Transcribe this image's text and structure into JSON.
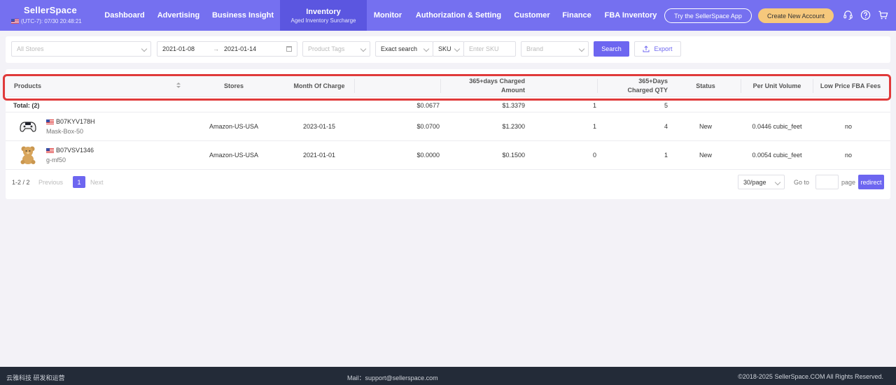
{
  "brand": {
    "name": "SellerSpace",
    "time": "(UTC-7): 07/30 20:48:21"
  },
  "nav": {
    "items": [
      {
        "label": "Dashboard"
      },
      {
        "label": "Advertising"
      },
      {
        "label": "Business Insight"
      },
      {
        "label": "Inventory",
        "sub": "Aged Inventory Surcharge"
      },
      {
        "label": "Monitor"
      },
      {
        "label": "Authorization & Setting"
      },
      {
        "label": "Customer"
      },
      {
        "label": "Finance"
      },
      {
        "label": "FBA Inventory"
      }
    ],
    "try_app": "Try the SellerSpace App",
    "create_account": "Create New Account",
    "icons": [
      "headset-icon",
      "help-icon",
      "cart-icon"
    ]
  },
  "filters": {
    "stores_placeholder": "All Stores",
    "date_start": "2021-01-08",
    "date_arrow": "→",
    "date_end": "2021-01-14",
    "tags_placeholder": "Product Tags",
    "search_mode": "Exact search",
    "field": "SKU",
    "sku_placeholder": "Enter SKU",
    "brand_placeholder": "Brand",
    "search_button": "Search",
    "export_button": "Export"
  },
  "table": {
    "headers": {
      "products": "Products",
      "stores": "Stores",
      "month": "Month Of Charge",
      "amount_l1": "365+days Charged",
      "amount_l2": "Amount",
      "qty_l1": "365+Days",
      "qty_l2": "Charged QTY",
      "status": "Status",
      "volume": "Per Unit Volume",
      "low_price": "Low Price FBA Fees"
    },
    "total": {
      "label": "Total: (2)",
      "unit_price": "$0.0677",
      "amount": "$1.3379",
      "qty_a": "1",
      "qty_b": "5"
    },
    "rows": [
      {
        "asin": "B07KYV178H",
        "sku": "Mask-Box-50",
        "store": "Amazon-US-USA",
        "month": "2023-01-15",
        "unit_price": "$0.0700",
        "amount": "$1.2300",
        "qty_a": "1",
        "qty_b": "4",
        "status": "New",
        "volume": "0.0446 cubic_feet",
        "low_price": "no"
      },
      {
        "asin": "B07VSV1346",
        "sku": "g-mf50",
        "store": "Amazon-US-USA",
        "month": "2021-01-01",
        "unit_price": "$0.0000",
        "amount": "$0.1500",
        "qty_a": "0",
        "qty_b": "1",
        "status": "New",
        "volume": "0.0054 cubic_feet",
        "low_price": "no"
      }
    ]
  },
  "pagination": {
    "range": "1-2 / 2",
    "prev": "Previous",
    "page": "1",
    "next": "Next",
    "per_page": "30/page",
    "goto": "Go to",
    "page_label": "page",
    "redirect": "redirect"
  },
  "footer": {
    "left": "云雅科技 研发和运营",
    "mail": "Mail：support@sellerspace.com",
    "copyright": "©2018-2025 SellerSpace.COM All Rights Reserved."
  },
  "colors": {
    "primary": "#7570f0",
    "active_nav": "#5b56e0",
    "highlight": "#e03a3a",
    "accent_button": "#f6c87c"
  }
}
